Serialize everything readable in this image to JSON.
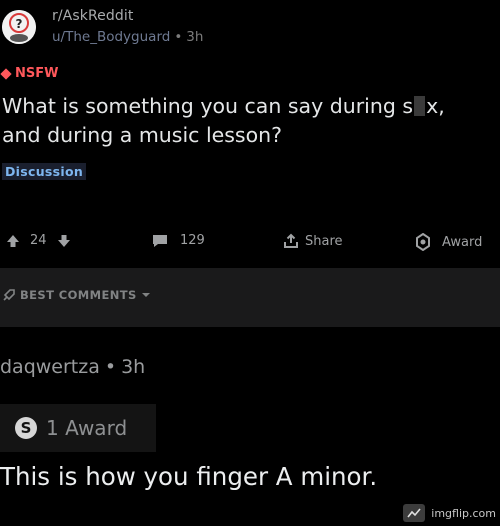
{
  "post": {
    "subreddit": "r/AskReddit",
    "author": "u/The_Bodyguard",
    "time": "3h",
    "nsfw_label": "NSFW",
    "title_part1": "What is something you can say during s",
    "title_part2": "x,",
    "title_line2": "and during a music lesson?",
    "flair": "Discussion",
    "colors": {
      "nsfw": "#ff585b",
      "flair_text": "#7eb6ef",
      "author": "#6f7a92"
    }
  },
  "actions": {
    "upvote_count": "24",
    "comments_count": "129",
    "share_label": "Share",
    "award_label": "Award",
    "icons": {
      "upvote": "upvote-arrow-icon",
      "downvote": "downvote-arrow-icon",
      "comments": "comment-bubble-icon",
      "share": "share-icon",
      "award": "award-icon"
    }
  },
  "sort": {
    "label": "BEST COMMENTS"
  },
  "comment": {
    "author": "daqwertza",
    "time": "3h",
    "award_text": "1 Award",
    "body": "This is how you finger A minor."
  },
  "watermark": {
    "text": "imgflip.com"
  }
}
